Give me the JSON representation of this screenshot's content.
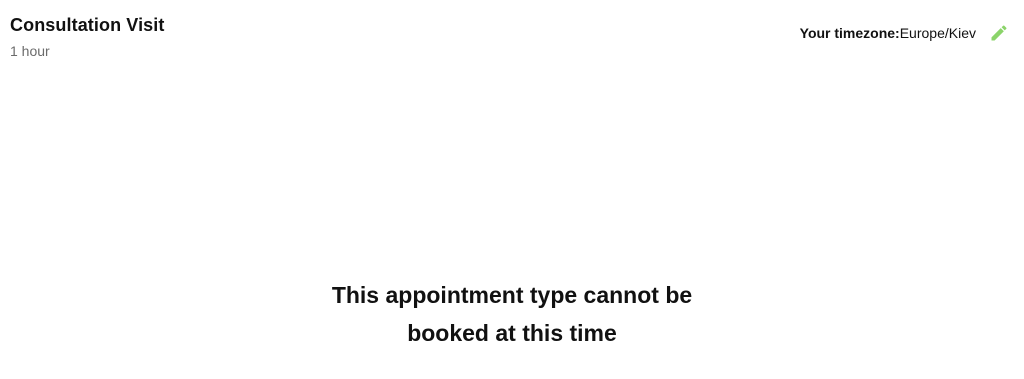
{
  "appointment": {
    "title": "Consultation Visit",
    "duration": "1 hour"
  },
  "timezone": {
    "label": "Your timezone:",
    "value": "Europe/Kiev",
    "edit_icon": "pencil-icon",
    "edit_icon_color": "#8bd46a"
  },
  "message": {
    "line1": "This appointment type cannot be",
    "line2": "booked at this time"
  }
}
